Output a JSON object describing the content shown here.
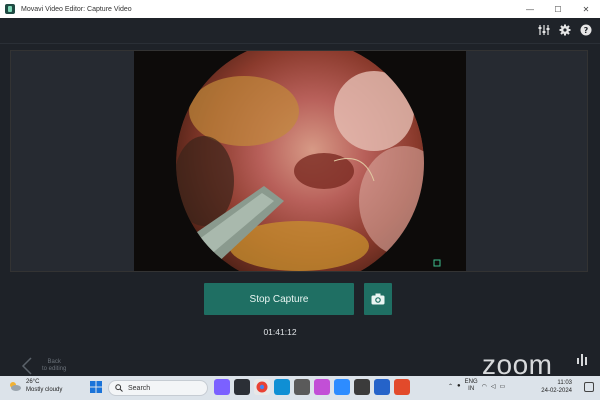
{
  "window": {
    "title": "Movavi Video Editor: Capture Video",
    "controls": [
      "—",
      "☐",
      "✕"
    ]
  },
  "header": {
    "icons": [
      "settings-sliders-icon",
      "gear-icon",
      "help-icon"
    ]
  },
  "capture": {
    "stop_label": "Stop Capture",
    "timer": "01:41:12",
    "snapshot_icon": "camera-icon"
  },
  "back": {
    "line1": "Back",
    "line2": "to editing"
  },
  "watermark": {
    "text": "zoom"
  },
  "taskbar": {
    "weather_temp": "26°C",
    "weather_desc": "Mostly cloudy",
    "search_label": "Search",
    "lang_line1": "ENG",
    "lang_line2": "IN",
    "time": "11:03",
    "date": "24-02-2024"
  },
  "colors": {
    "accent": "#1f6f63",
    "background": "#1e2228"
  }
}
